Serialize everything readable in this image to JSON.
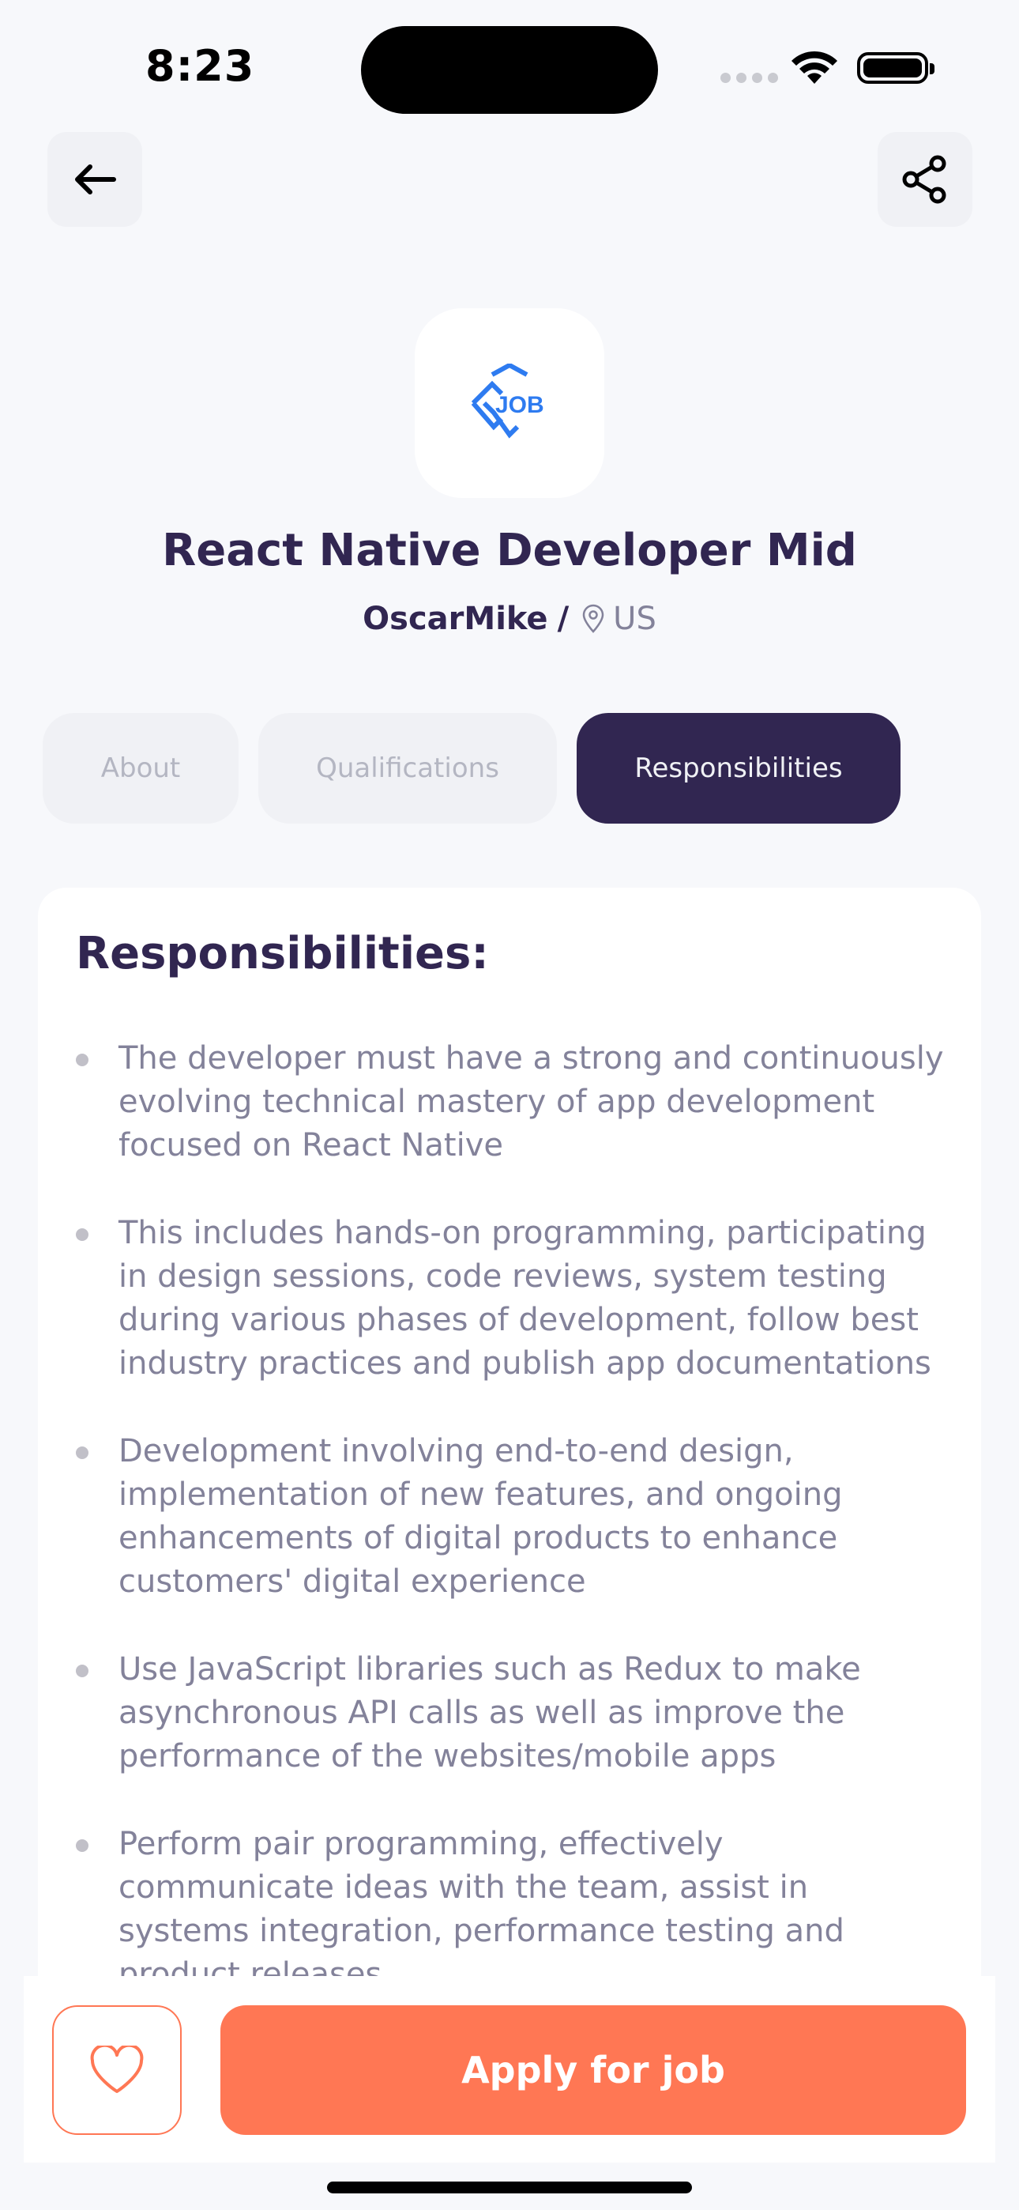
{
  "status_bar": {
    "time": "8:23"
  },
  "header": {
    "back_icon": "arrow-left-icon",
    "share_icon": "share-icon"
  },
  "company": {
    "logo_text": "JOB",
    "job_title": "React Native Developer Mid",
    "name": "OscarMike",
    "separator": "/",
    "location": "US"
  },
  "tabs": [
    {
      "label": "About",
      "active": false
    },
    {
      "label": "Qualifications",
      "active": false
    },
    {
      "label": "Responsibilities",
      "active": true
    }
  ],
  "content": {
    "title": "Responsibilities:",
    "points": [
      "The developer must have a strong and continuously evolving technical mastery of app development focused on React Native",
      "This includes hands-on programming, participating in design sessions, code reviews, system testing during various phases of development, follow best industry practices and publish app documentations",
      "Development involving end-to-end design, implementation of new features, and ongoing enhancements of digital products to enhance customers' digital experience",
      "Use JavaScript libraries such as Redux to make asynchronous API calls as well as improve the performance of the websites/mobile apps",
      "Perform pair programming, effectively communicate ideas with the team, assist in systems integration, performance testing and product releases"
    ]
  },
  "footer": {
    "like_icon": "heart-icon",
    "apply_label": "Apply for job"
  },
  "colors": {
    "primary": "#312651",
    "accent": "#FF7754",
    "gray": "#83829A",
    "background": "#F7F8FB",
    "logo_blue": "#2E7BF0"
  }
}
